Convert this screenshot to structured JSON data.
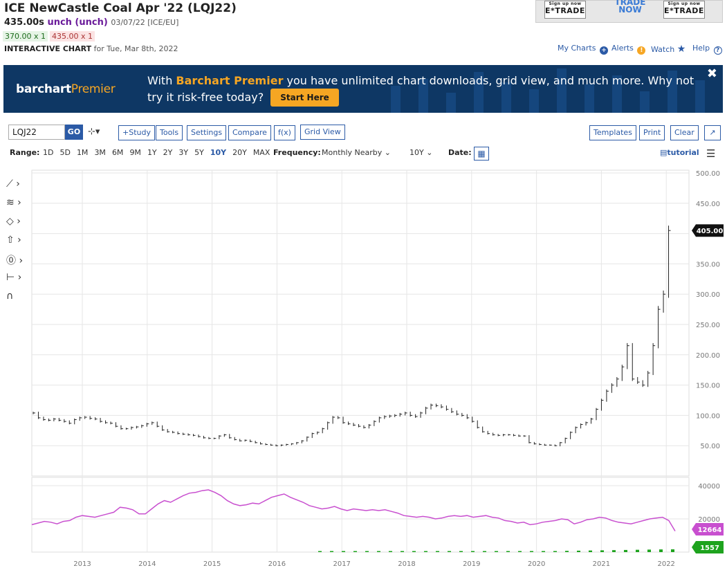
{
  "header": {
    "title": "ICE NewCastle Coal Apr '22 (LQJ22)",
    "price": "435.00s",
    "change": "unch (unch)",
    "meta": "03/07/22 [ICE/EU]",
    "bid": "370.00 x 1",
    "ask": "435.00 x 1",
    "interactive_label": "INTERACTIVE CHART",
    "interactive_date": "for Tue, Mar 8th, 2022"
  },
  "ads": {
    "etrade1_small": "Sign up now",
    "etrade1": "E*TRADE",
    "trade_now": "TRADE NOW",
    "etrade2_small": "Sign up now",
    "etrade2": "E*TRADE"
  },
  "toplinks": {
    "my_charts": "My Charts",
    "alerts": "Alerts",
    "watch": "Watch",
    "help": "Help"
  },
  "banner": {
    "logo_main": "barchart",
    "logo_accent": "Premier",
    "text_pre": "With ",
    "text_hl": "Barchart Premier",
    "text_post": " you have unlimited chart downloads, grid view, and much more. Why not try it risk-free today?",
    "cta": "Start Here",
    "close": "✖"
  },
  "toolbar": {
    "symbol": "LQJ22",
    "go": "GO",
    "bar_type": "⊹▾",
    "study": "+Study",
    "tools": "Tools",
    "settings": "Settings",
    "compare": "Compare",
    "fx": "f(x)",
    "grid_view": "Grid View",
    "templates": "Templates",
    "print": "Print",
    "clear": "Clear",
    "expand": "↗"
  },
  "range": {
    "label": "Range:",
    "options": [
      "1D",
      "5D",
      "1M",
      "3M",
      "6M",
      "9M",
      "1Y",
      "2Y",
      "3Y",
      "5Y",
      "10Y",
      "20Y",
      "MAX"
    ],
    "active": "10Y",
    "frequency_label": "Frequency:",
    "frequency_value": "Monthly Nearby",
    "period_value": "10Y",
    "date_label": "Date:",
    "tutorial": "tutorial"
  },
  "colors": {
    "accent": "#2b5aa6",
    "banner_bg": "#0e3764",
    "premier": "#f6a623",
    "volume_line": "#c84fcf",
    "volume_bar": "#1ea31e"
  },
  "chart_data": [
    {
      "type": "bar",
      "title": "",
      "x_years": [
        "2013",
        "2014",
        "2015",
        "2016",
        "2017",
        "2018",
        "2019",
        "2020",
        "2021",
        "2022"
      ],
      "ylim": [
        0,
        500
      ],
      "y_ticks": [
        "500.00",
        "450.00",
        "400.00",
        "350.00",
        "300.00",
        "250.00",
        "200.00",
        "150.00",
        "100.00",
        "50.00"
      ],
      "last_price_label": "405.00",
      "series": [
        {
          "values": [
            104,
            96,
            93,
            92,
            94,
            92,
            90,
            87,
            93,
            96,
            97,
            95,
            94,
            90,
            88,
            87,
            82,
            78,
            78,
            80,
            81,
            83,
            86,
            88,
            82,
            76,
            73,
            72,
            70,
            69,
            68,
            67,
            65,
            63,
            62,
            62,
            66,
            68,
            63,
            60,
            58,
            59,
            57,
            55,
            53,
            52,
            51,
            50,
            51,
            52,
            53,
            55,
            58,
            64,
            70,
            72,
            78,
            88,
            97,
            96,
            88,
            86,
            84,
            82,
            80,
            84,
            90,
            96,
            98,
            99,
            100,
            102,
            104,
            100,
            98,
            104,
            112,
            117,
            116,
            114,
            110,
            106,
            102,
            100,
            96,
            90,
            80,
            73,
            70,
            68,
            67,
            68,
            68,
            67,
            66,
            66,
            55,
            53,
            52,
            51,
            51,
            50,
            55,
            62,
            72,
            80,
            85,
            88,
            94,
            110,
            125,
            140,
            150,
            160,
            180,
            215,
            160,
            155,
            150,
            170,
            215,
            275,
            300,
            405
          ]
        }
      ]
    },
    {
      "type": "line",
      "title": "",
      "ylim": [
        0,
        45000
      ],
      "y_ticks": [
        "40000",
        "20000"
      ],
      "last_value_label": "12664",
      "series": [
        {
          "values": [
            16500,
            17500,
            18500,
            18000,
            17000,
            18500,
            19000,
            21000,
            22000,
            21500,
            21000,
            22000,
            23000,
            24000,
            27000,
            26500,
            25500,
            23000,
            23000,
            26000,
            29000,
            31000,
            30000,
            32000,
            34000,
            35500,
            36000,
            37000,
            37500,
            36000,
            34000,
            31000,
            29000,
            28000,
            28500,
            29500,
            29000,
            31000,
            33000,
            34000,
            35000,
            33000,
            31500,
            30000,
            28000,
            27000,
            26000,
            26500,
            27500,
            26000,
            25000,
            26000,
            25500,
            25000,
            25500,
            25000,
            25500,
            24500,
            23500,
            22000,
            21500,
            21000,
            21500,
            21000,
            20000,
            20500,
            21500,
            22000,
            21500,
            22000,
            21000,
            21500,
            22000,
            21000,
            20500,
            19000,
            18500,
            17500,
            18000,
            16500,
            17000,
            18000,
            18500,
            19000,
            20000,
            19500,
            17000,
            18000,
            19500,
            20000,
            21000,
            20500,
            19000,
            18000,
            17500,
            17000,
            18000,
            19000,
            20000,
            20500,
            21000,
            19000,
            12664
          ]
        }
      ]
    },
    {
      "type": "bar",
      "title": "",
      "last_value_label": "1557",
      "series": [
        {
          "values": [
            100,
            120,
            90,
            80,
            140,
            160,
            110,
            130,
            150,
            120,
            100,
            110,
            130,
            140,
            200,
            300,
            400,
            350,
            500,
            450,
            600,
            700,
            800,
            900,
            1000,
            1100,
            1200,
            1300,
            1400,
            1500,
            1557
          ]
        }
      ]
    }
  ]
}
